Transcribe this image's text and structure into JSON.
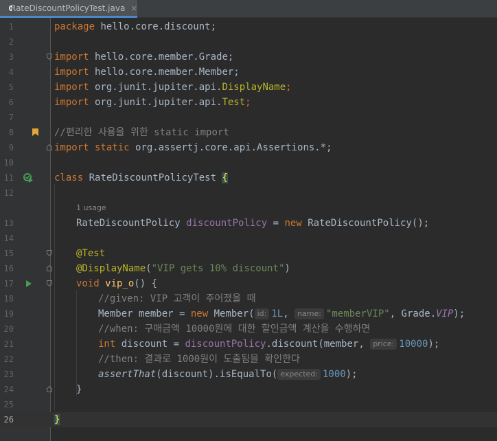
{
  "tab": {
    "filename": "RateDiscountPolicyTest.java",
    "close": "×",
    "icon": "java-class-icon"
  },
  "gutter": {
    "line_numbers": [
      "1",
      "2",
      "3",
      "4",
      "5",
      "6",
      "7",
      "8",
      "9",
      "10",
      "11",
      "12",
      "13",
      "14",
      "15",
      "16",
      "17",
      "18",
      "19",
      "20",
      "21",
      "22",
      "23",
      "24",
      "25",
      "26"
    ]
  },
  "code": {
    "l1_kw": "package",
    "l1_rest": " hello.core.discount;",
    "l3_kw": "import",
    "l3_rest": " hello.core.member.Grade;",
    "l4_kw": "import",
    "l4_rest": " hello.core.member.Member;",
    "l5_kw": "import",
    "l5_pkg": " org.junit.jupiter.api.",
    "l5_cls": "DisplayName",
    "l5_end": ";",
    "l6_kw": "import",
    "l6_pkg": " org.junit.jupiter.api.",
    "l6_cls": "Test",
    "l6_end": ";",
    "l8_cmt": "//편리한 사용을 위한 static import",
    "l9_kw": "import static",
    "l9_rest": " org.assertj.core.api.Assertions.*;",
    "l11_kw": "class",
    "l11_name": " RateDiscountPolicyTest ",
    "l11_brace": "{",
    "usage": "1 usage",
    "l13_type": "RateDiscountPolicy ",
    "l13_field": "discountPolicy",
    "l13_eq": " = ",
    "l13_new": "new",
    "l13_ctor": " RateDiscountPolicy();",
    "l15_anno": "@Test",
    "l16_anno": "@DisplayName",
    "l16_open": "(",
    "l16_str": "\"VIP gets 10% discount\"",
    "l16_close": ")",
    "l17_kw": "void",
    "l17_name": " vip_o",
    "l17_rest": "() {",
    "l18_cmt": "//given: VIP 고객이 주어졌을 때",
    "l19_a": "Member member = ",
    "l19_new": "new",
    "l19_b": " Member(",
    "l19_hint1": "id:",
    "l19_num": "1L",
    "l19_c": ", ",
    "l19_hint2": "name:",
    "l19_str": "\"memberVIP\"",
    "l19_d": ", Grade.",
    "l19_vip": "VIP",
    "l19_e": ");",
    "l20_cmt": "//when: 구매금액 10000원에 대한 할인금액 계산을 수행하면",
    "l21_kw": "int",
    "l21_a": " discount = ",
    "l21_field": "discountPolicy",
    "l21_b": ".discount(member, ",
    "l21_hint": "price:",
    "l21_num": "10000",
    "l21_c": ");",
    "l22_cmt": "//then: 결과로 1000원이 도출됨을 확인한다",
    "l23_fn": "assertThat",
    "l23_a": "(discount).isEqualTo(",
    "l23_hint": "expected:",
    "l23_num": "1000",
    "l23_b": ");",
    "l24": "}",
    "l26": "}"
  },
  "colors": {
    "background": "#2b2b2b",
    "keyword": "#cc7832",
    "string": "#6a8759",
    "number": "#6897bb",
    "comment": "#808080",
    "annotation": "#bbb529",
    "field": "#9876aa",
    "run_icon": "#499c54"
  }
}
